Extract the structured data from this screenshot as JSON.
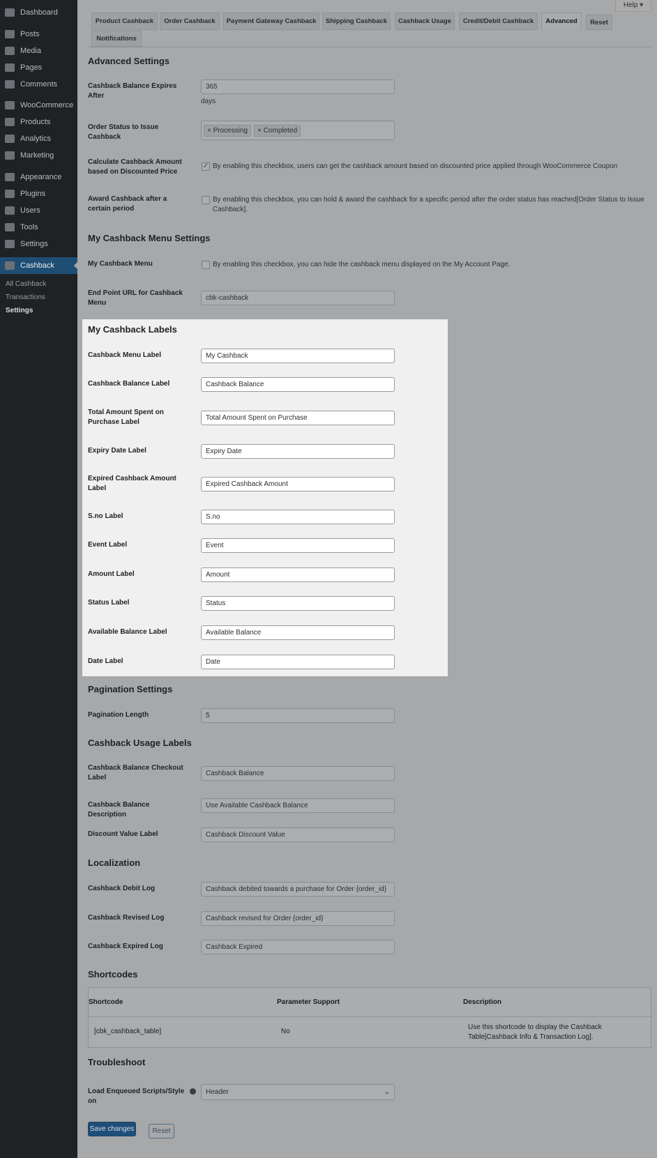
{
  "sidebar": {
    "items": [
      {
        "label": "Dashboard",
        "icon": "dashboard-icon"
      },
      {
        "label": "Posts",
        "icon": "pin-icon"
      },
      {
        "label": "Media",
        "icon": "media-icon"
      },
      {
        "label": "Pages",
        "icon": "pages-icon"
      },
      {
        "label": "Comments",
        "icon": "comment-icon"
      },
      {
        "label": "WooCommerce",
        "icon": "woocommerce-icon"
      },
      {
        "label": "Products",
        "icon": "products-icon"
      },
      {
        "label": "Analytics",
        "icon": "analytics-icon"
      },
      {
        "label": "Marketing",
        "icon": "megaphone-icon"
      },
      {
        "label": "Appearance",
        "icon": "brush-icon"
      },
      {
        "label": "Plugins",
        "icon": "plugin-icon"
      },
      {
        "label": "Users",
        "icon": "user-icon"
      },
      {
        "label": "Tools",
        "icon": "wrench-icon"
      },
      {
        "label": "Settings",
        "icon": "settings-icon"
      },
      {
        "label": "Cashback",
        "icon": "cashback-icon"
      }
    ],
    "submenu": [
      "All Cashback",
      "Transactions",
      "Settings"
    ]
  },
  "help": "Help ▾",
  "tabs": [
    "Product Cashback",
    "Order Cashback",
    "Payment Gateway Cashback",
    "Shipping Cashback",
    "Cashback Usage",
    "Credit/Debit Cashback",
    "Advanced",
    "Reset",
    "Notifications"
  ],
  "headings": [
    "Advanced Settings",
    "My Cashback Menu Settings",
    "My Cashback Labels",
    "Pagination Settings",
    "Cashback Usage Labels",
    "Localization",
    "Shortcodes",
    "Troubleshoot"
  ],
  "advanced": {
    "expires_label": "Cashback Balance Expires After",
    "expires_value": "365",
    "expires_unit": "days",
    "order_status_label": "Order Status to Issue Cashback",
    "order_status_tags": [
      "× Processing",
      "× Completed"
    ],
    "discount_label": "Calculate Cashback Amount based on Discounted Price",
    "discount_text": "By enabling this checkbox, users can get the cashback amount based on discounted price applied through WooCommerce Coupon",
    "discount_checked": true,
    "award_label": "Award Cashback after a certain period",
    "award_text": "By enabling this checkbox, you can hold & award the cashback for a specific period after the order status has reached[Order Status to Issue Cashback].",
    "award_checked": false
  },
  "menu": {
    "hide_label": "My Cashback Menu",
    "hide_text": "By enabling this checkbox, you can hide the cashback menu displayed on the My Account Page.",
    "hide_checked": false,
    "endpoint_label": "End Point URL for Cashback Menu",
    "endpoint_value": "cbk-cashback"
  },
  "labels": [
    {
      "label": "Cashback Menu Label",
      "value": "My Cashback"
    },
    {
      "label": "Cashback Balance Label",
      "value": "Cashback Balance"
    },
    {
      "label": "Total Amount Spent on Purchase Label",
      "value": "Total Amount Spent on Purchase"
    },
    {
      "label": "Expiry Date Label",
      "value": "Expiry Date"
    },
    {
      "label": "Expired Cashback Amount Label",
      "value": "Expired Cashback Amount"
    },
    {
      "label": "S.no Label",
      "value": "S.no"
    },
    {
      "label": "Event Label",
      "value": "Event"
    },
    {
      "label": "Amount Label",
      "value": "Amount"
    },
    {
      "label": "Status Label",
      "value": "Status"
    },
    {
      "label": "Available Balance Label",
      "value": "Available Balance"
    },
    {
      "label": "Date Label",
      "value": "Date"
    }
  ],
  "pagination": {
    "label": "Pagination Length",
    "value": "5"
  },
  "usage": [
    {
      "label": "Cashback Balance Checkout Label",
      "value": "Cashback Balance"
    },
    {
      "label": "Cashback Balance Description",
      "value": "Use Available Cashback Balance"
    },
    {
      "label": "Discount Value Label",
      "value": "Cashback Discount Value"
    }
  ],
  "localization": [
    {
      "label": "Cashback Debit Log",
      "value": "Cashback debited towards a purchase for Order {order_id}"
    },
    {
      "label": "Cashback Revised Log",
      "value": "Cashback revised for Order {order_id}"
    },
    {
      "label": "Cashback Expired Log",
      "value": "Cashback Expired"
    }
  ],
  "shortcodes": {
    "headers": [
      "Shortcode",
      "Parameter Support",
      "Description"
    ],
    "row": [
      "[cbk_cashback_table]",
      "No",
      "Use this shortcode to display the Cashback Table[Cashback Info & Transaction Log]."
    ]
  },
  "troubleshoot": {
    "label": "Load Enqueued Scripts/Style on",
    "value": "Header"
  },
  "buttons": {
    "save": "Save changes",
    "reset": "Reset"
  }
}
